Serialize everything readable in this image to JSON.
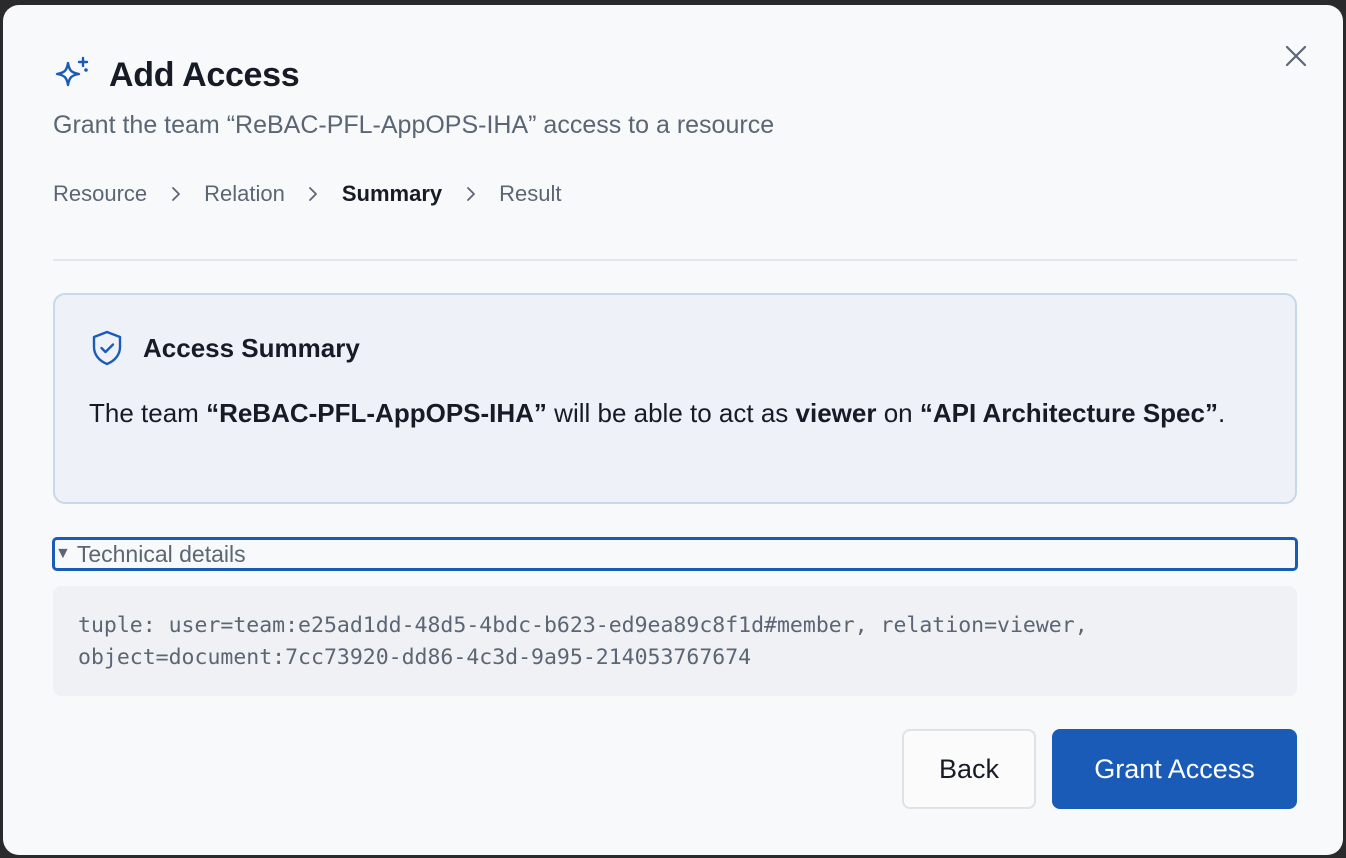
{
  "dialog": {
    "title": "Add Access",
    "subtitle": "Grant the team “ReBAC-PFL-AppOPS-IHA” access to a resource",
    "icons": {
      "title": "sparkle-icon",
      "close": "close-icon",
      "summary": "shield-check-icon",
      "step_separator": "chevron-right-icon"
    },
    "colors": {
      "accent": "#1b5bb8",
      "text": "#161b26",
      "muted": "#5b6675"
    }
  },
  "steps": [
    {
      "label": "Resource",
      "active": false
    },
    {
      "label": "Relation",
      "active": false
    },
    {
      "label": "Summary",
      "active": true
    },
    {
      "label": "Result",
      "active": false
    }
  ],
  "summary": {
    "title": "Access Summary",
    "text_prefix": "The team ",
    "team": "“ReBAC-PFL-AppOPS-IHA”",
    "text_mid1": " will be able to act as ",
    "relation": "viewer",
    "text_mid2": " on ",
    "object": "“API Architecture Spec”",
    "text_suffix": "."
  },
  "technical": {
    "toggle_glyph": "▼",
    "toggle_label": "Technical details",
    "code_line1": "tuple: user=team:e25ad1dd-48d5-4bdc-b623-ed9ea89c8f1d#member, relation=viewer,",
    "code_line2": "object=document:7cc73920-dd86-4c3d-9a95-214053767674"
  },
  "actions": {
    "back_label": "Back",
    "grant_label": "Grant Access"
  }
}
